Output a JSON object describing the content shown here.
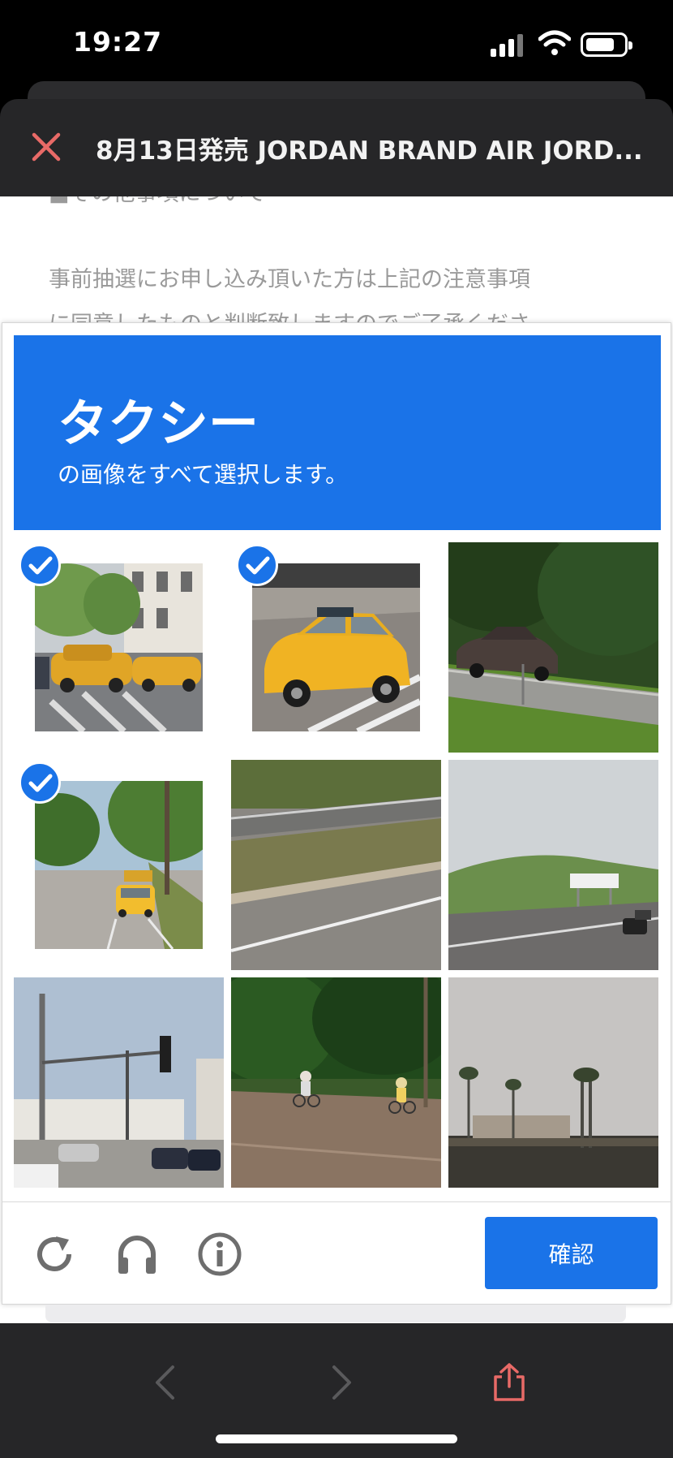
{
  "status_bar": {
    "time": "19:27"
  },
  "header": {
    "title": "8月13日発売 JORDAN BRAND AIR JORD..."
  },
  "page": {
    "partial_heading": "■その他事項について",
    "paragraph_line1": "事前抽選にお申し込み頂いた方は上記の注意事項",
    "paragraph_line2": "に同意したものと判断致しますのでご了承くださ"
  },
  "captcha": {
    "target_word": "タクシー",
    "instruction": "の画像をすべて選択します。",
    "accent_color": "#1a73e8",
    "tiles": [
      {
        "name": "tile-1-taxis-intersection",
        "selected": true
      },
      {
        "name": "tile-2-taxi-closeup",
        "selected": true
      },
      {
        "name": "tile-3-suv-highway",
        "selected": false
      },
      {
        "name": "tile-4-taxi-tree-road",
        "selected": true
      },
      {
        "name": "tile-5-empty-road",
        "selected": false
      },
      {
        "name": "tile-6-highway-hills",
        "selected": false
      },
      {
        "name": "tile-7-streetlights",
        "selected": false
      },
      {
        "name": "tile-8-cyclists",
        "selected": false
      },
      {
        "name": "tile-9-palm-trees",
        "selected": false
      }
    ],
    "footer": {
      "reload_icon": "reload-icon",
      "audio_icon": "headphones-icon",
      "info_icon": "info-icon",
      "verify_label": "確認"
    }
  },
  "toolbar": {
    "back": "chevron-left-icon",
    "forward": "chevron-right-icon",
    "share": "share-icon"
  }
}
